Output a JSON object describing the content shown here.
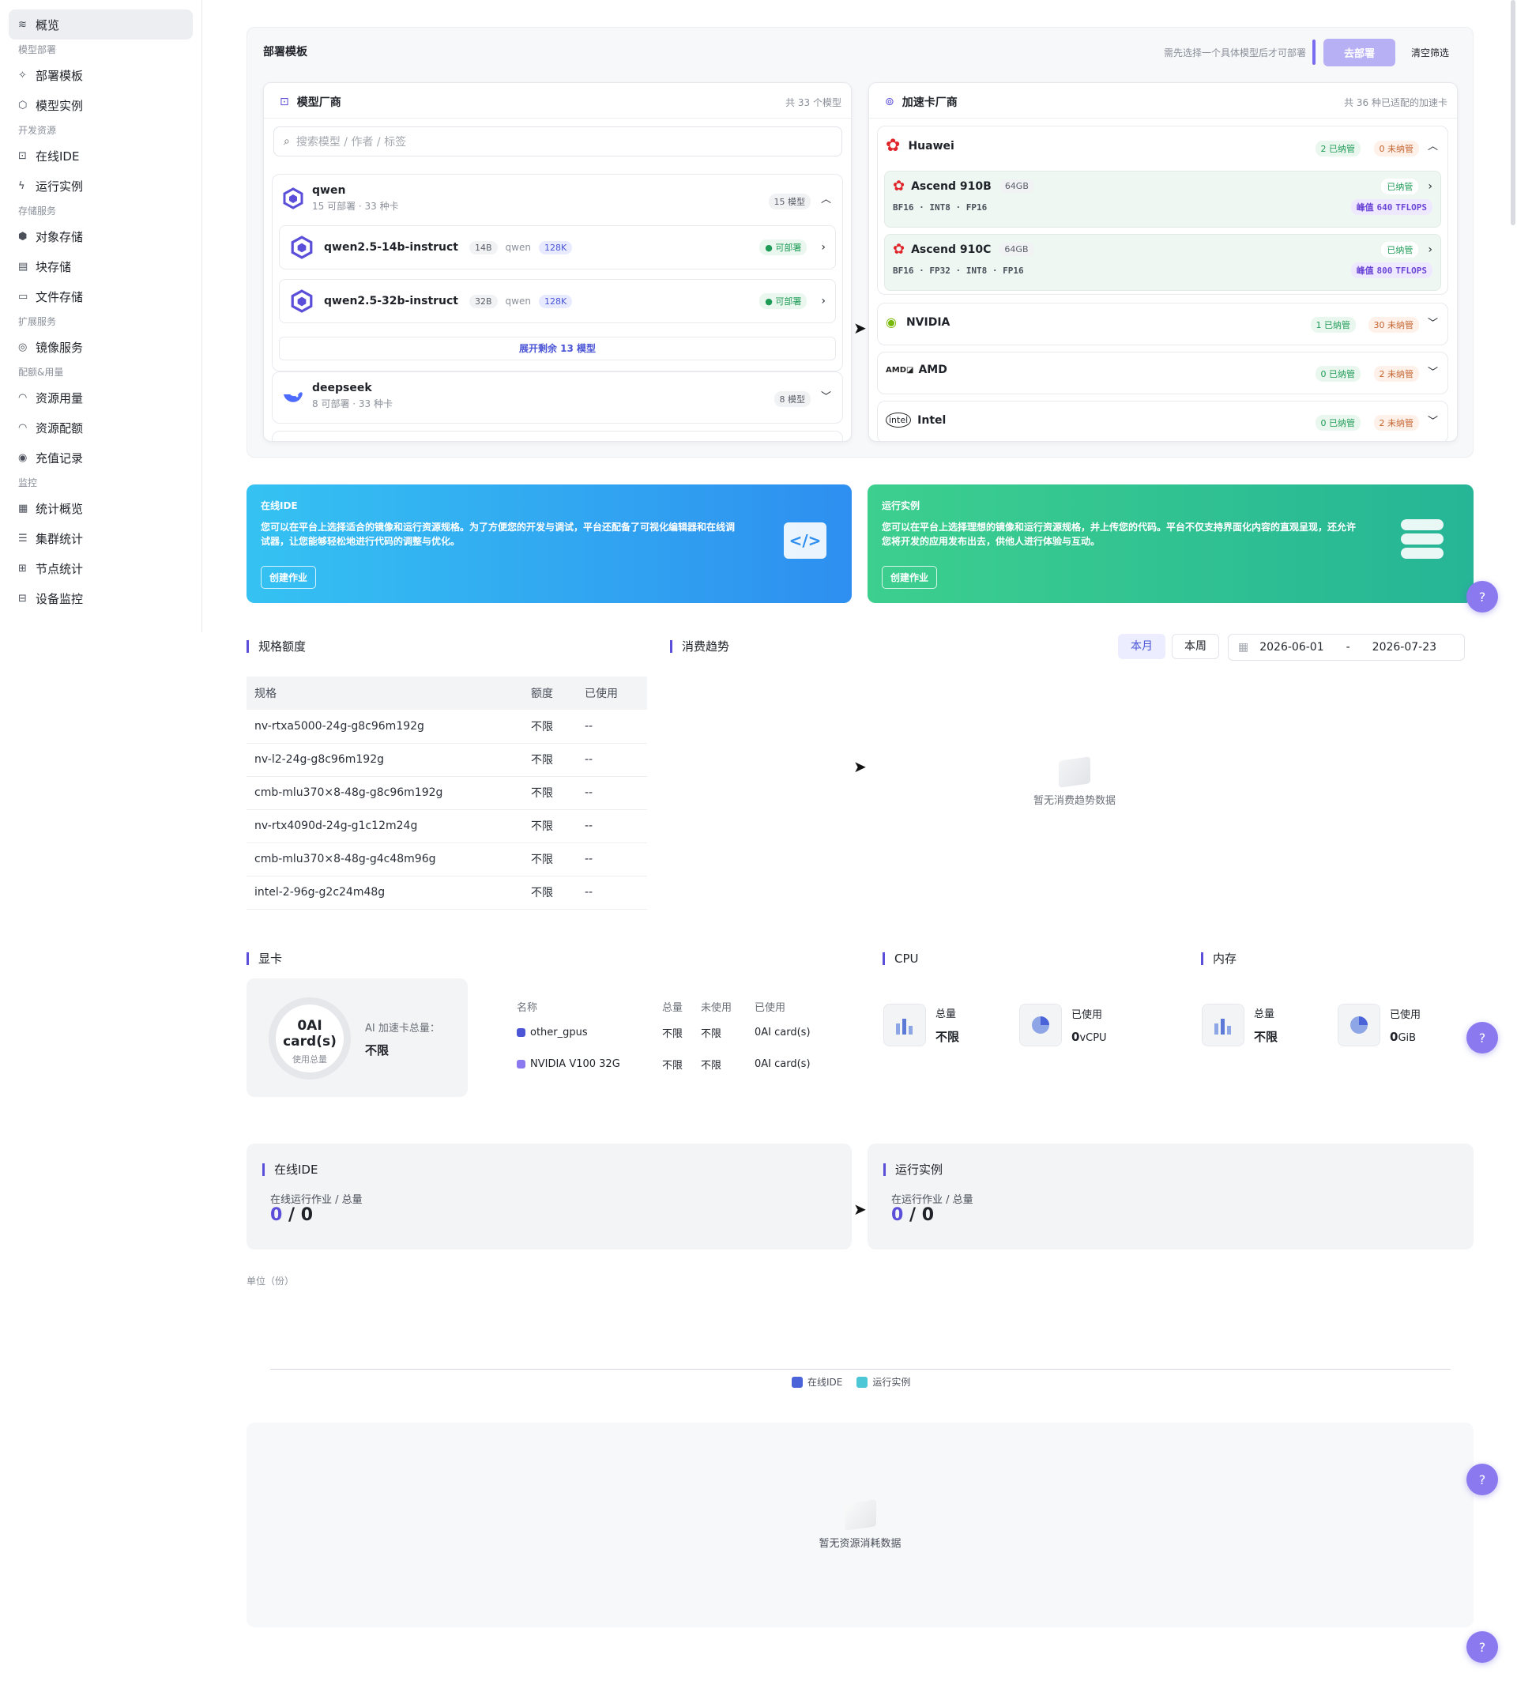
{
  "sidebar": {
    "items": [
      {
        "label": "概览",
        "icon": "layers-icon",
        "active": true
      },
      {
        "group": "模型部署"
      },
      {
        "label": "部署模板",
        "icon": "sparkle-icon"
      },
      {
        "label": "模型实例",
        "icon": "cube-icon"
      },
      {
        "group": "开发资源"
      },
      {
        "label": "在线IDE",
        "icon": "code-square-icon"
      },
      {
        "label": "运行实例",
        "icon": "bolt-icon"
      },
      {
        "group": "存储服务"
      },
      {
        "label": "对象存储",
        "icon": "box-icon"
      },
      {
        "label": "块存储",
        "icon": "blocks-icon"
      },
      {
        "label": "文件存储",
        "icon": "folder-icon"
      },
      {
        "group": "扩展服务"
      },
      {
        "label": "镜像服务",
        "icon": "disc-icon"
      },
      {
        "group": "配额&用量"
      },
      {
        "label": "资源用量",
        "icon": "gauge-icon"
      },
      {
        "label": "资源配额",
        "icon": "gauge-icon"
      },
      {
        "label": "充值记录",
        "icon": "coin-icon"
      },
      {
        "group": "监控"
      },
      {
        "label": "统计概览",
        "icon": "grid-icon"
      },
      {
        "label": "集群统计",
        "icon": "server-icon"
      },
      {
        "label": "节点统计",
        "icon": "chip-icon"
      },
      {
        "label": "设备监控",
        "icon": "monitor-icon"
      }
    ]
  },
  "deploy": {
    "title": "部署模板",
    "hint": "需先选择一个具体模型后才可部署",
    "deploy_btn": "去部署",
    "clear_btn": "清空筛选",
    "model_vendor": {
      "title": "模型厂商",
      "count": "共 33 个模型",
      "search_placeholder": "搜索模型 / 作者 / 标签",
      "vendors": [
        {
          "name": "qwen",
          "sub": "15 可部署 · 33 种卡",
          "badge": "15 模型",
          "models": [
            {
              "name": "qwen2.5-14b-instruct",
              "size": "14B",
              "author": "qwen",
              "ctx": "128K",
              "status": "可部署"
            },
            {
              "name": "qwen2.5-32b-instruct",
              "size": "32B",
              "author": "qwen",
              "ctx": "128K",
              "status": "可部署"
            }
          ],
          "expand": "展开剩余 13 模型"
        },
        {
          "name": "deepseek",
          "sub": "8 可部署 · 33 种卡",
          "badge": "8 模型"
        }
      ]
    },
    "accelerator": {
      "title": "加速卡厂商",
      "count": "共 36 种已适配的加速卡",
      "vendors": [
        {
          "name": "Huawei",
          "managed": "2 已纳管",
          "unmanaged": "0 未纳管",
          "chips": [
            {
              "name": "Ascend 910B",
              "mem": "64GB",
              "status": "已纳管",
              "precisions": "BF16 · INT8 · FP16",
              "peak_label": "峰值",
              "peak": "640",
              "unit": "TFLOPS"
            },
            {
              "name": "Ascend 910C",
              "mem": "64GB",
              "status": "已纳管",
              "precisions": "BF16 · FP32 · INT8 · FP16",
              "peak_label": "峰值",
              "peak": "800",
              "unit": "TFLOPS"
            }
          ]
        },
        {
          "name": "NVIDIA",
          "managed": "1 已纳管",
          "unmanaged": "30 未纳管"
        },
        {
          "name": "AMD",
          "managed": "0 已纳管",
          "unmanaged": "2 未纳管"
        },
        {
          "name": "Intel",
          "managed": "0 已纳管",
          "unmanaged": "2 未纳管"
        }
      ]
    }
  },
  "banners": {
    "ide": {
      "tag": "在线IDE",
      "desc": "您可以在平台上选择适合的镜像和运行资源规格。为了方便您的开发与调试，平台还配备了可视化编辑器和在线调试器，让您能够轻松地进行代码的调整与优化。",
      "btn": "创建作业"
    },
    "run": {
      "tag": "运行实例",
      "desc": "您可以在平台上选择理想的镜像和运行资源规格，并上传您的代码。平台不仅支持界面化内容的直观呈现，还允许您将开发的应用发布出去，供他人进行体验与互动。",
      "btn": "创建作业"
    }
  },
  "quota": {
    "title": "规格额度",
    "headers": [
      "规格",
      "额度",
      "已使用"
    ],
    "rows": [
      [
        "nv-rtxa5000-24g-g8c96m192g",
        "不限",
        "--"
      ],
      [
        "nv-l2-24g-g8c96m192g",
        "不限",
        "--"
      ],
      [
        "cmb-mlu370×8-48g-g8c96m192g",
        "不限",
        "--"
      ],
      [
        "nv-rtx4090d-24g-g1c12m24g",
        "不限",
        "--"
      ],
      [
        "cmb-mlu370×8-48g-g4c48m96g",
        "不限",
        "--"
      ],
      [
        "intel-2-96g-g2c24m48g",
        "不限",
        "--"
      ]
    ]
  },
  "trend": {
    "title": "消费趋势",
    "tab_month": "本月",
    "tab_week": "本周",
    "date_from": "2026-06-01",
    "date_sep": "-",
    "date_to": "2026-07-23",
    "empty": "暂无消费趋势数据"
  },
  "gpu": {
    "title": "显卡",
    "ring_value": "0AI card(s)",
    "ring_sub": "使用总量",
    "total_label": "AI 加速卡总量：",
    "total_value": "不限",
    "headers": [
      "名称",
      "总量",
      "未使用",
      "已使用"
    ],
    "rows": [
      {
        "name": "other_gpus",
        "color": "#4b55d6",
        "total": "不限",
        "free": "不限",
        "used": "0AI card(s)"
      },
      {
        "name": "NVIDIA V100 32G",
        "color": "#8b79f0",
        "total": "不限",
        "free": "不限",
        "used": "0AI card(s)"
      }
    ]
  },
  "cpu": {
    "title": "CPU",
    "total_label": "总量",
    "total_value": "不限",
    "used_label": "已使用",
    "used_value": "0",
    "used_unit": "vCPU"
  },
  "mem": {
    "title": "内存",
    "total_label": "总量",
    "total_value": "不限",
    "used_label": "已使用",
    "used_value": "0",
    "used_unit": "GiB"
  },
  "jobs": {
    "ide": {
      "title": "在线IDE",
      "label": "在线运行作业 / 总量",
      "running": "0",
      "sep": "/",
      "total": "0"
    },
    "run": {
      "title": "运行实例",
      "label": "在运行作业 / 总量",
      "running": "0",
      "sep": "/",
      "total": "0"
    }
  },
  "usage_chart": {
    "unit": "单位（份）",
    "legend": [
      {
        "name": "在线IDE",
        "color": "#4b63d9"
      },
      {
        "name": "运行实例",
        "color": "#4cc7d6"
      }
    ]
  },
  "resource": {
    "empty": "暂无资源消耗数据"
  },
  "colors": {
    "accent": "#5b4fd9",
    "ide_banner": "#2eaff0",
    "run_banner": "#2ec4a0"
  }
}
